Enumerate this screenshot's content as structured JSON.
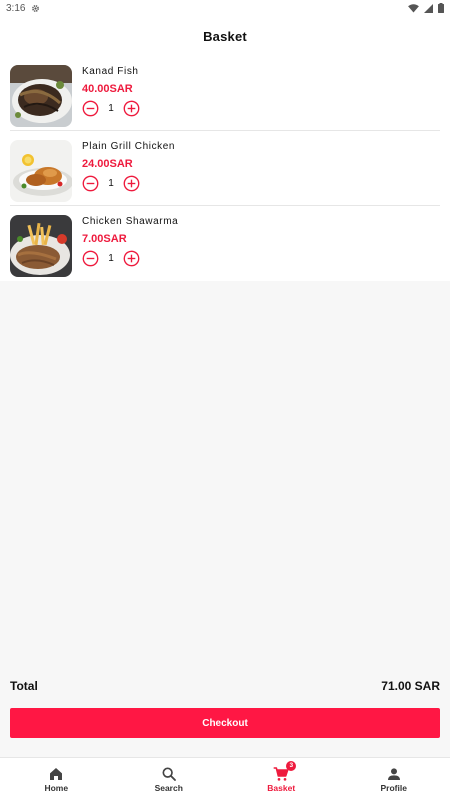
{
  "status_bar": {
    "time": "3:16"
  },
  "header": {
    "title": "Basket"
  },
  "items": [
    {
      "name": "Kanad Fish",
      "price": "40.00SAR",
      "quantity": "1"
    },
    {
      "name": "Plain Grill Chicken",
      "price": "24.00SAR",
      "quantity": "1"
    },
    {
      "name": "Chicken Shawarma",
      "price": "7.00SAR",
      "quantity": "1"
    }
  ],
  "summary": {
    "total_label": "Total",
    "total_value": "71.00 SAR"
  },
  "checkout": {
    "label": "Checkout"
  },
  "nav": {
    "items": [
      {
        "label": "Home",
        "icon": "home-icon"
      },
      {
        "label": "Search",
        "icon": "search-icon"
      },
      {
        "label": "Basket",
        "icon": "cart-icon",
        "badge": "3",
        "active": true
      },
      {
        "label": "Profile",
        "icon": "person-icon"
      }
    ]
  },
  "colors": {
    "accent": "#ee1a3d",
    "button": "#ff1744",
    "background": "#f7f7f7"
  }
}
